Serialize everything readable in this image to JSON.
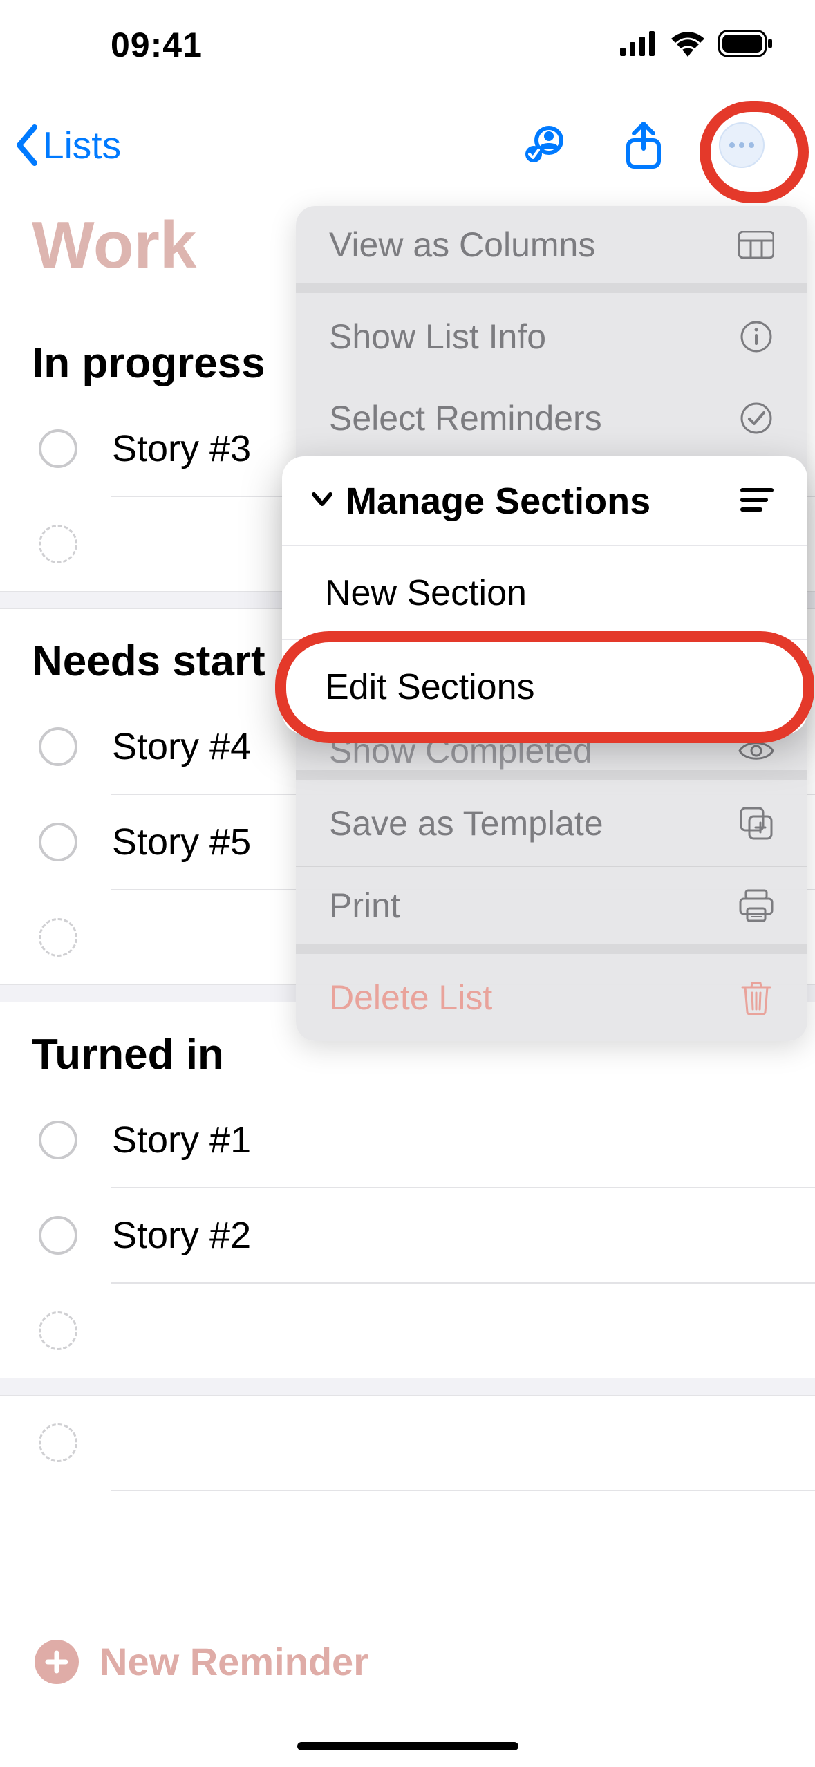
{
  "status": {
    "time": "09:41"
  },
  "nav": {
    "back_label": "Lists"
  },
  "list": {
    "title": "Work"
  },
  "sections": [
    {
      "header": "In progress",
      "items": [
        "Story #3"
      ]
    },
    {
      "header": "Needs start",
      "items": [
        "Story #4",
        "Story #5"
      ]
    },
    {
      "header": "Turned in",
      "items": [
        "Story #1",
        "Story #2"
      ]
    }
  ],
  "menu": {
    "view_columns": "View as Columns",
    "show_info": "Show List Info",
    "select_reminders": "Select Reminders",
    "show_completed": "Show Completed",
    "save_template": "Save as Template",
    "print": "Print",
    "delete_list": "Delete List"
  },
  "submenu": {
    "header": "Manage Sections",
    "new_section": "New Section",
    "edit_sections": "Edit Sections"
  },
  "bottom": {
    "new_reminder": "New Reminder"
  }
}
